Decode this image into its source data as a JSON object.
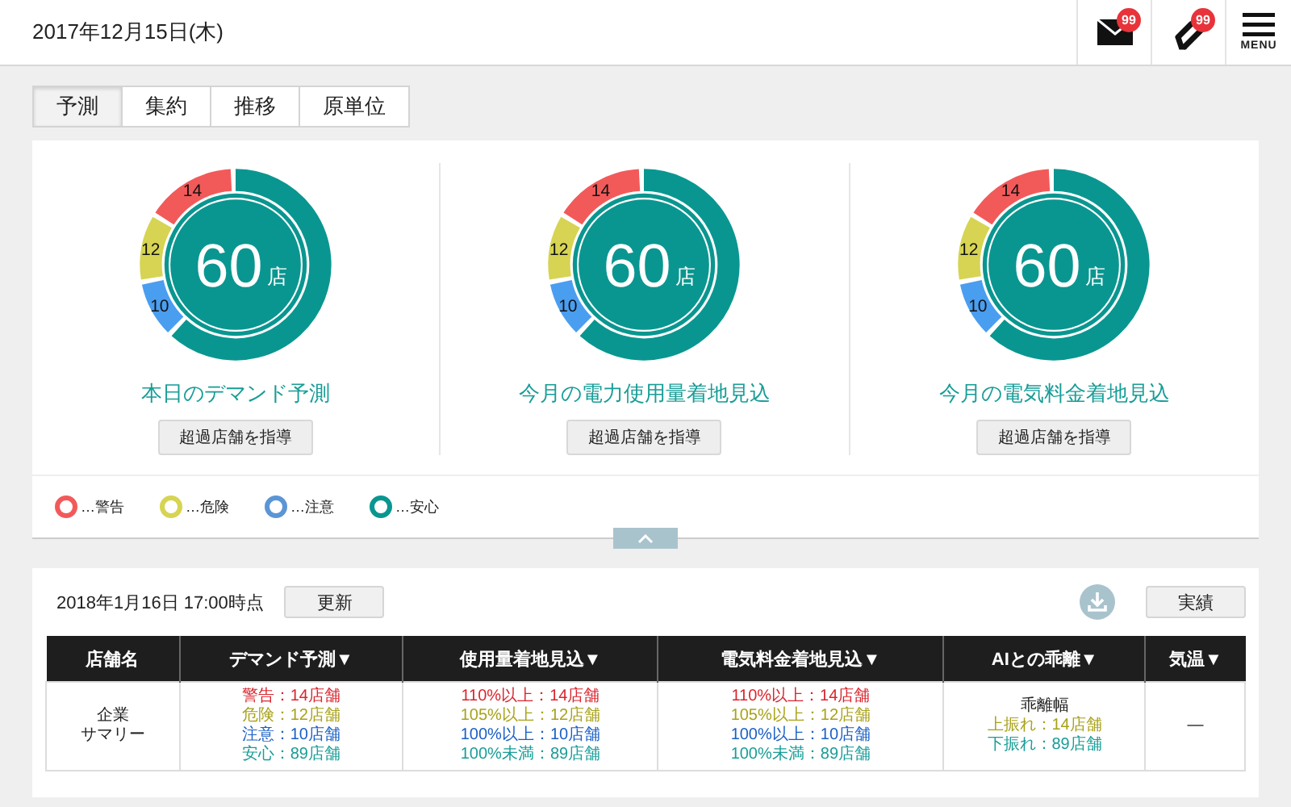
{
  "header": {
    "date": "2017年12月15日(木)",
    "mail_badge": "99",
    "link_badge": "99",
    "menu_label": "MENU"
  },
  "tabs": [
    {
      "label": "予測",
      "selected": true
    },
    {
      "label": "集約",
      "selected": false
    },
    {
      "label": "推移",
      "selected": false
    },
    {
      "label": "原単位",
      "selected": false
    }
  ],
  "summaries": [
    {
      "center_value": "60",
      "center_unit": "店",
      "segments": [
        {
          "label": "14",
          "color": "#f25a5a"
        },
        {
          "label": "12",
          "color": "#d6d452"
        },
        {
          "label": "10",
          "color": "#4a9ef0"
        },
        {
          "color": "#0a9690"
        }
      ],
      "title": "本日のデマンド予測",
      "button": "超過店舗を指導"
    },
    {
      "center_value": "60",
      "center_unit": "店",
      "segments": [
        {
          "label": "14",
          "color": "#f25a5a"
        },
        {
          "label": "12",
          "color": "#d6d452"
        },
        {
          "label": "10",
          "color": "#4a9ef0"
        },
        {
          "color": "#0a9690"
        }
      ],
      "title": "今月の電力使用量着地見込",
      "button": "超過店舗を指導"
    },
    {
      "center_value": "60",
      "center_unit": "店",
      "segments": [
        {
          "label": "14",
          "color": "#f25a5a"
        },
        {
          "label": "12",
          "color": "#d6d452"
        },
        {
          "label": "10",
          "color": "#4a9ef0"
        },
        {
          "color": "#0a9690"
        }
      ],
      "title": "今月の電気料金着地見込",
      "button": "超過店舗を指導"
    }
  ],
  "legend": [
    {
      "label": "…警告",
      "color": "#f25a5a"
    },
    {
      "label": "…危険",
      "color": "#d6d452"
    },
    {
      "label": "…注意",
      "color": "#5b95d6"
    },
    {
      "label": "…安心",
      "color": "#0a9690"
    }
  ],
  "report": {
    "timestamp": "2018年1月16日 17:00時点",
    "refresh_button": "更新",
    "results_button": "実績",
    "table": {
      "columns": [
        "店舗名",
        "デマンド予測▼",
        "使用量着地見込▼",
        "電気料金着地見込▼",
        "AIとの乖離▼",
        "気温▼"
      ],
      "rows": [
        {
          "cells": [
            {
              "lines": [
                {
                  "text": "企業"
                },
                {
                  "text": "サマリー"
                }
              ]
            },
            {
              "lines": [
                {
                  "text": "警告：14店舗",
                  "color": "#d8262f"
                },
                {
                  "text": "危険：12店舗",
                  "color": "#a9a21a"
                },
                {
                  "text": "注意：10店舗",
                  "color": "#1a5fc4"
                },
                {
                  "text": "安心：89店舗",
                  "color": "#189d97"
                }
              ]
            },
            {
              "lines": [
                {
                  "text": "110%以上：14店舗",
                  "color": "#d8262f"
                },
                {
                  "text": "105%以上：12店舗",
                  "color": "#a9a21a"
                },
                {
                  "text": "100%以上：10店舗",
                  "color": "#1a5fc4"
                },
                {
                  "text": "100%未満：89店舗",
                  "color": "#189d97"
                }
              ]
            },
            {
              "lines": [
                {
                  "text": "110%以上：14店舗",
                  "color": "#d8262f"
                },
                {
                  "text": "105%以上：12店舗",
                  "color": "#a9a21a"
                },
                {
                  "text": "100%以上：10店舗",
                  "color": "#1a5fc4"
                },
                {
                  "text": "100%未満：89店舗",
                  "color": "#189d97"
                }
              ]
            },
            {
              "lines": [
                {
                  "text": "乖離幅"
                },
                {
                  "text": "上振れ：14店舗",
                  "color": "#a9a21a"
                },
                {
                  "text": "下振れ：89店舗",
                  "color": "#189d97"
                }
              ]
            },
            {
              "lines": [
                {
                  "text": "—"
                }
              ]
            }
          ]
        }
      ]
    }
  }
}
